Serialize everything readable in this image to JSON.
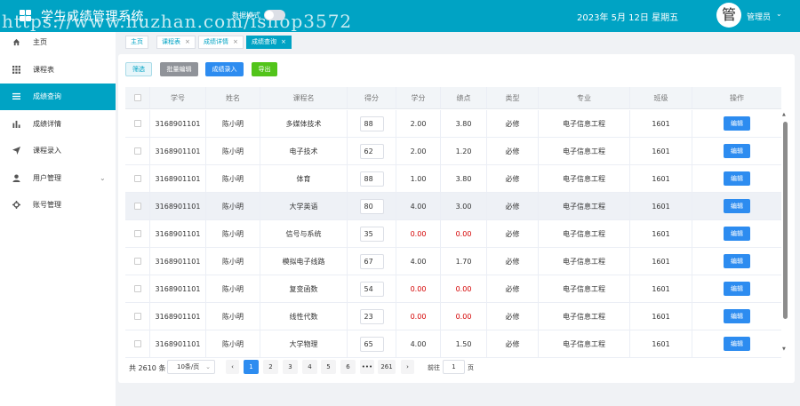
{
  "header": {
    "title": "学生成绩管理系统",
    "watermark": "https://www.huzhan.com/ishop3572",
    "data_mode_label": "数据模式",
    "datetime": "2023年 5月 12日   星期五",
    "avatar_char": "管",
    "user_name": "管理员",
    "brand_color": "#00a3c4"
  },
  "sidebar": {
    "items": [
      {
        "label": "主页",
        "icon": "home-icon"
      },
      {
        "label": "课程表",
        "icon": "grid-icon"
      },
      {
        "label": "成绩查询",
        "icon": "list-icon"
      },
      {
        "label": "成绩详情",
        "icon": "bar-chart-icon"
      },
      {
        "label": "课程录入",
        "icon": "send-icon"
      },
      {
        "label": "用户管理",
        "icon": "user-icon"
      },
      {
        "label": "账号管理",
        "icon": "gear-icon"
      }
    ],
    "active_index": 2
  },
  "tabs": [
    {
      "label": "主页",
      "closable": false
    },
    {
      "label": "课程表",
      "closable": true
    },
    {
      "label": "成绩详情",
      "closable": true
    },
    {
      "label": "成绩查询",
      "closable": true
    }
  ],
  "toolbar": {
    "filter_label": "筛选",
    "batch_edit_label": "批量编辑",
    "entry_label": "成绩录入",
    "export_label": "导出"
  },
  "table": {
    "columns": [
      "学号",
      "姓名",
      "课程名",
      "得分",
      "学分",
      "绩点",
      "类型",
      "专业",
      "班级",
      "操作"
    ],
    "edit_label": "编辑",
    "rows": [
      {
        "id": "3168901101",
        "name": "陈小明",
        "course": "多媒体技术",
        "score": "88",
        "credit": "2.00",
        "gpa": "3.80",
        "type": "必修",
        "major": "电子信息工程",
        "class": "1601",
        "fail": false
      },
      {
        "id": "3168901101",
        "name": "陈小明",
        "course": "电子技术",
        "score": "62",
        "credit": "2.00",
        "gpa": "1.20",
        "type": "必修",
        "major": "电子信息工程",
        "class": "1601",
        "fail": false
      },
      {
        "id": "3168901101",
        "name": "陈小明",
        "course": "体育",
        "score": "88",
        "credit": "1.00",
        "gpa": "3.80",
        "type": "必修",
        "major": "电子信息工程",
        "class": "1601",
        "fail": false
      },
      {
        "id": "3168901101",
        "name": "陈小明",
        "course": "大学英语",
        "score": "80",
        "credit": "4.00",
        "gpa": "3.00",
        "type": "必修",
        "major": "电子信息工程",
        "class": "1601",
        "fail": false
      },
      {
        "id": "3168901101",
        "name": "陈小明",
        "course": "信号与系统",
        "score": "35",
        "credit": "0.00",
        "gpa": "0.00",
        "type": "必修",
        "major": "电子信息工程",
        "class": "1601",
        "fail": true
      },
      {
        "id": "3168901101",
        "name": "陈小明",
        "course": "模拟电子线路",
        "score": "67",
        "credit": "4.00",
        "gpa": "1.70",
        "type": "必修",
        "major": "电子信息工程",
        "class": "1601",
        "fail": false
      },
      {
        "id": "3168901101",
        "name": "陈小明",
        "course": "复变函数",
        "score": "54",
        "credit": "0.00",
        "gpa": "0.00",
        "type": "必修",
        "major": "电子信息工程",
        "class": "1601",
        "fail": true
      },
      {
        "id": "3168901101",
        "name": "陈小明",
        "course": "线性代数",
        "score": "23",
        "credit": "0.00",
        "gpa": "0.00",
        "type": "必修",
        "major": "电子信息工程",
        "class": "1601",
        "fail": true
      },
      {
        "id": "3168901101",
        "name": "陈小明",
        "course": "大学物理",
        "score": "65",
        "credit": "4.00",
        "gpa": "1.50",
        "type": "必修",
        "major": "电子信息工程",
        "class": "1601",
        "fail": false
      }
    ],
    "highlighted_row_index": 3
  },
  "pagination": {
    "total_label": "共 2610 条",
    "page_size": "10条/页",
    "prev_icon": "chevron-left-icon",
    "next_icon": "chevron-right-icon",
    "pages": [
      "1",
      "2",
      "3",
      "4",
      "5",
      "6",
      "•••",
      "261"
    ],
    "current_page": "1",
    "goto_label": "前往",
    "goto_value": "1",
    "page_suffix": "页"
  }
}
